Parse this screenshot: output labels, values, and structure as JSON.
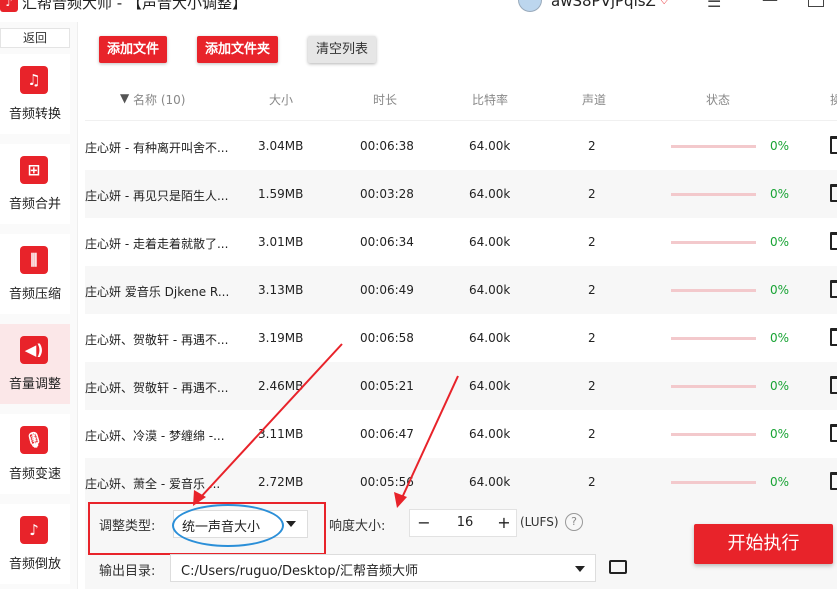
{
  "titlebar": {
    "app_name": "汇帮音频大师",
    "page": "- 【声音大小调整】",
    "user": "awS8PVjPqlsZ"
  },
  "sidebar": {
    "back": "返回",
    "items": [
      {
        "label": "音频转换",
        "icon": "music-convert-icon",
        "glyph": "♫"
      },
      {
        "label": "音频合并",
        "icon": "merge-icon",
        "glyph": "⊞"
      },
      {
        "label": "音频压缩",
        "icon": "compress-icon",
        "glyph": "⫼"
      },
      {
        "label": "音量调整",
        "icon": "volume-icon",
        "glyph": "◀)"
      },
      {
        "label": "音频变速",
        "icon": "microphone-icon",
        "glyph": "🎙"
      },
      {
        "label": "音频倒放",
        "icon": "music-note-icon",
        "glyph": "♪"
      }
    ],
    "active_index": 3
  },
  "toolbar": {
    "add_file": "添加文件",
    "add_folder": "添加文件夹",
    "clear_list": "清空列表"
  },
  "table": {
    "columns": {
      "name": "名称 (10)",
      "size": "大小",
      "duration": "时长",
      "bitrate": "比特率",
      "channels": "声道",
      "status": "状态",
      "op": "操"
    },
    "rows": [
      {
        "name": "庄心妍 - 有种离开叫舍不...",
        "size": "3.04MB",
        "duration": "00:06:38",
        "bitrate": "64.00k",
        "channels": "2",
        "progress": "0%"
      },
      {
        "name": "庄心妍 - 再见只是陌生人...",
        "size": "1.59MB",
        "duration": "00:03:28",
        "bitrate": "64.00k",
        "channels": "2",
        "progress": "0%"
      },
      {
        "name": "庄心妍 - 走着走着就散了...",
        "size": "3.01MB",
        "duration": "00:06:34",
        "bitrate": "64.00k",
        "channels": "2",
        "progress": "0%"
      },
      {
        "name": "庄心妍 爱音乐 Djkene R...",
        "size": "3.13MB",
        "duration": "00:06:49",
        "bitrate": "64.00k",
        "channels": "2",
        "progress": "0%"
      },
      {
        "name": "庄心妍、贺敬轩 - 再遇不...",
        "size": "3.19MB",
        "duration": "00:06:58",
        "bitrate": "64.00k",
        "channels": "2",
        "progress": "0%"
      },
      {
        "name": "庄心妍、贺敬轩 - 再遇不...",
        "size": "2.46MB",
        "duration": "00:05:21",
        "bitrate": "64.00k",
        "channels": "2",
        "progress": "0%"
      },
      {
        "name": "庄心妍、冷漠 - 梦缠绵 -...",
        "size": "3.11MB",
        "duration": "00:06:47",
        "bitrate": "64.00k",
        "channels": "2",
        "progress": "0%"
      },
      {
        "name": "庄心妍、萧全 - 爱音乐 ...",
        "size": "2.72MB",
        "duration": "00:05:56",
        "bitrate": "64.00k",
        "channels": "2",
        "progress": "0%"
      }
    ]
  },
  "settings": {
    "adjust_type_label": "调整类型:",
    "adjust_type_value": "统一声音大小",
    "loudness_label": "响度大小:",
    "loudness_minus": "−",
    "loudness_value": "16",
    "loudness_plus": "+",
    "loudness_unit": "(LUFS)",
    "help": "?",
    "output_label": "输出目录:",
    "output_path": "C:/Users/ruguo/Desktop/汇帮音频大师",
    "start": "开始执行"
  },
  "colors": {
    "accent": "#e8232a",
    "progress_text": "#18a334",
    "annotation_blue": "#2b8fd8"
  }
}
